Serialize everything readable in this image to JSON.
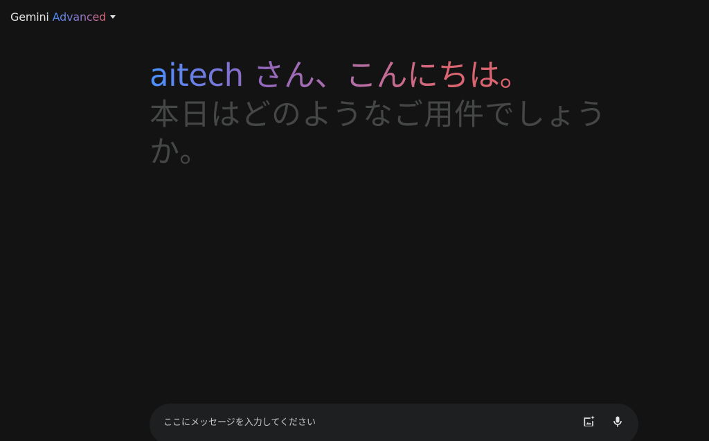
{
  "header": {
    "model_name": "Gemini",
    "model_tier": "Advanced",
    "switcher_icon": "caret-down-icon"
  },
  "greeting": {
    "hello": "aitech さん、こんにちは。",
    "prompt": "本日はどのようなご用件でしょうか。"
  },
  "input": {
    "placeholder": "ここにメッセージを入力してください",
    "value": "",
    "buttons": [
      {
        "icon": "add-image-icon"
      },
      {
        "icon": "microphone-icon"
      }
    ]
  },
  "colors": {
    "background": "#131314",
    "input_background": "#1e1f20",
    "gradient_start": "#4b90ff",
    "gradient_mid": "#9168c0",
    "gradient_end": "#d96570",
    "sub_text": "#444746"
  }
}
